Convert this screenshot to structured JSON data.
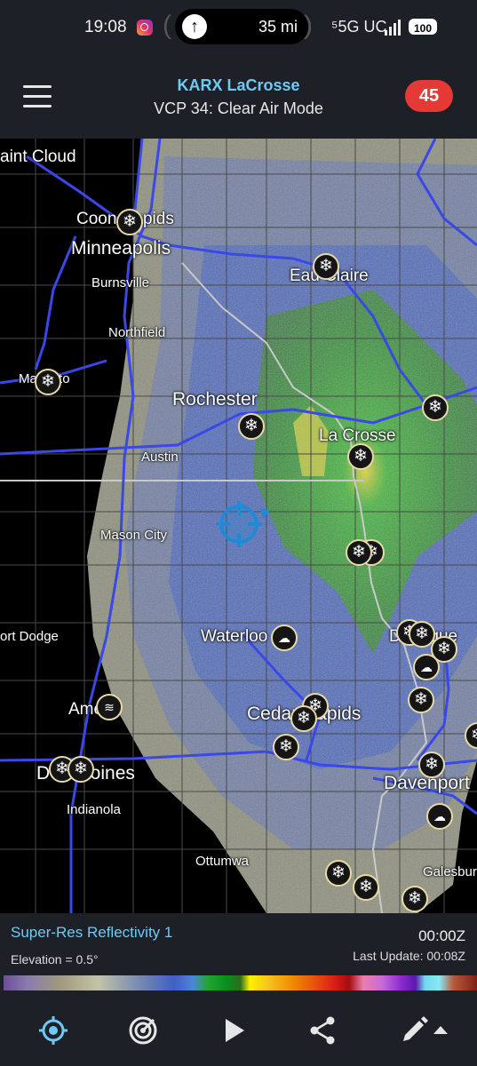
{
  "status_bar": {
    "time": "19:08",
    "nav_arrow": "↑",
    "nav_distance": "35 mi",
    "network": "⁵5G UC",
    "battery": "100"
  },
  "header": {
    "station": "KARX LaCrosse",
    "mode": "VCP 34: Clear Air Mode",
    "alert_count": "45"
  },
  "map": {
    "cities": [
      {
        "name": "aint Cloud",
        "size": "mid"
      },
      {
        "name": "Coon Rapids",
        "size": "mid"
      },
      {
        "name": "Minneapolis",
        "size": "big"
      },
      {
        "name": "Burnsville",
        "size": "sm"
      },
      {
        "name": "Northfield",
        "size": "sm"
      },
      {
        "name": "Mankato",
        "size": "sm"
      },
      {
        "name": "Rochester",
        "size": "big"
      },
      {
        "name": "Austin",
        "size": "sm"
      },
      {
        "name": "Eau Claire",
        "size": "mid"
      },
      {
        "name": "La Crosse",
        "size": "mid"
      },
      {
        "name": "Mason City",
        "size": "sm"
      },
      {
        "name": "ort Dodge",
        "size": "sm"
      },
      {
        "name": "Waterloo",
        "size": "mid"
      },
      {
        "name": "Dubuque",
        "size": "mid"
      },
      {
        "name": "Ames",
        "size": "mid"
      },
      {
        "name": "Cedar Rapids",
        "size": "big"
      },
      {
        "name": "Des Moines",
        "size": "big"
      },
      {
        "name": "Indianola",
        "size": "sm"
      },
      {
        "name": "Ottumwa",
        "size": "sm"
      },
      {
        "name": "Davenport",
        "size": "big"
      },
      {
        "name": "Galesburg",
        "size": "sm"
      }
    ],
    "weather_icons": [
      {
        "type": "snow",
        "glyph": "❄"
      },
      {
        "type": "snow",
        "glyph": "❄"
      },
      {
        "type": "snow",
        "glyph": "❄"
      },
      {
        "type": "snow",
        "glyph": "❄"
      },
      {
        "type": "snow",
        "glyph": "❄"
      },
      {
        "type": "snow",
        "glyph": "❄"
      },
      {
        "type": "snow",
        "glyph": "❄"
      },
      {
        "type": "snow",
        "glyph": "❄"
      },
      {
        "type": "snow-cloud",
        "glyph": "☁"
      },
      {
        "type": "snow",
        "glyph": "❄"
      },
      {
        "type": "snow",
        "glyph": "❄"
      },
      {
        "type": "cloud-rain",
        "glyph": "☁"
      },
      {
        "type": "snow",
        "glyph": "❄"
      },
      {
        "type": "wind-snow",
        "glyph": "≋"
      },
      {
        "type": "snow",
        "glyph": "❄"
      },
      {
        "type": "snow",
        "glyph": "❄"
      },
      {
        "type": "snow",
        "glyph": "❄"
      },
      {
        "type": "snow",
        "glyph": "❄"
      },
      {
        "type": "snow",
        "glyph": "❄"
      },
      {
        "type": "snow",
        "glyph": "❄"
      },
      {
        "type": "snow",
        "glyph": "❄"
      },
      {
        "type": "cloud-rain",
        "glyph": "☁"
      },
      {
        "type": "snow",
        "glyph": "❄"
      },
      {
        "type": "snow",
        "glyph": "❄"
      },
      {
        "type": "snow",
        "glyph": "❄"
      },
      {
        "type": "snow",
        "glyph": "❄"
      }
    ]
  },
  "legend": {
    "product": "Super-Res Reflectivity 1",
    "elevation": "Elevation = 0.5°",
    "time": "00:00Z",
    "last_update": "Last Update: 00:08Z"
  },
  "colors": {
    "accent": "#6ecaf5",
    "alert_badge": "#e53935",
    "highway": "#3a48e8",
    "icon_ring": "#e7d9a7"
  },
  "bottom_bar": {
    "icons": [
      "location-target-icon",
      "radar-icon",
      "play-icon",
      "share-icon",
      "pencil-icon"
    ]
  }
}
